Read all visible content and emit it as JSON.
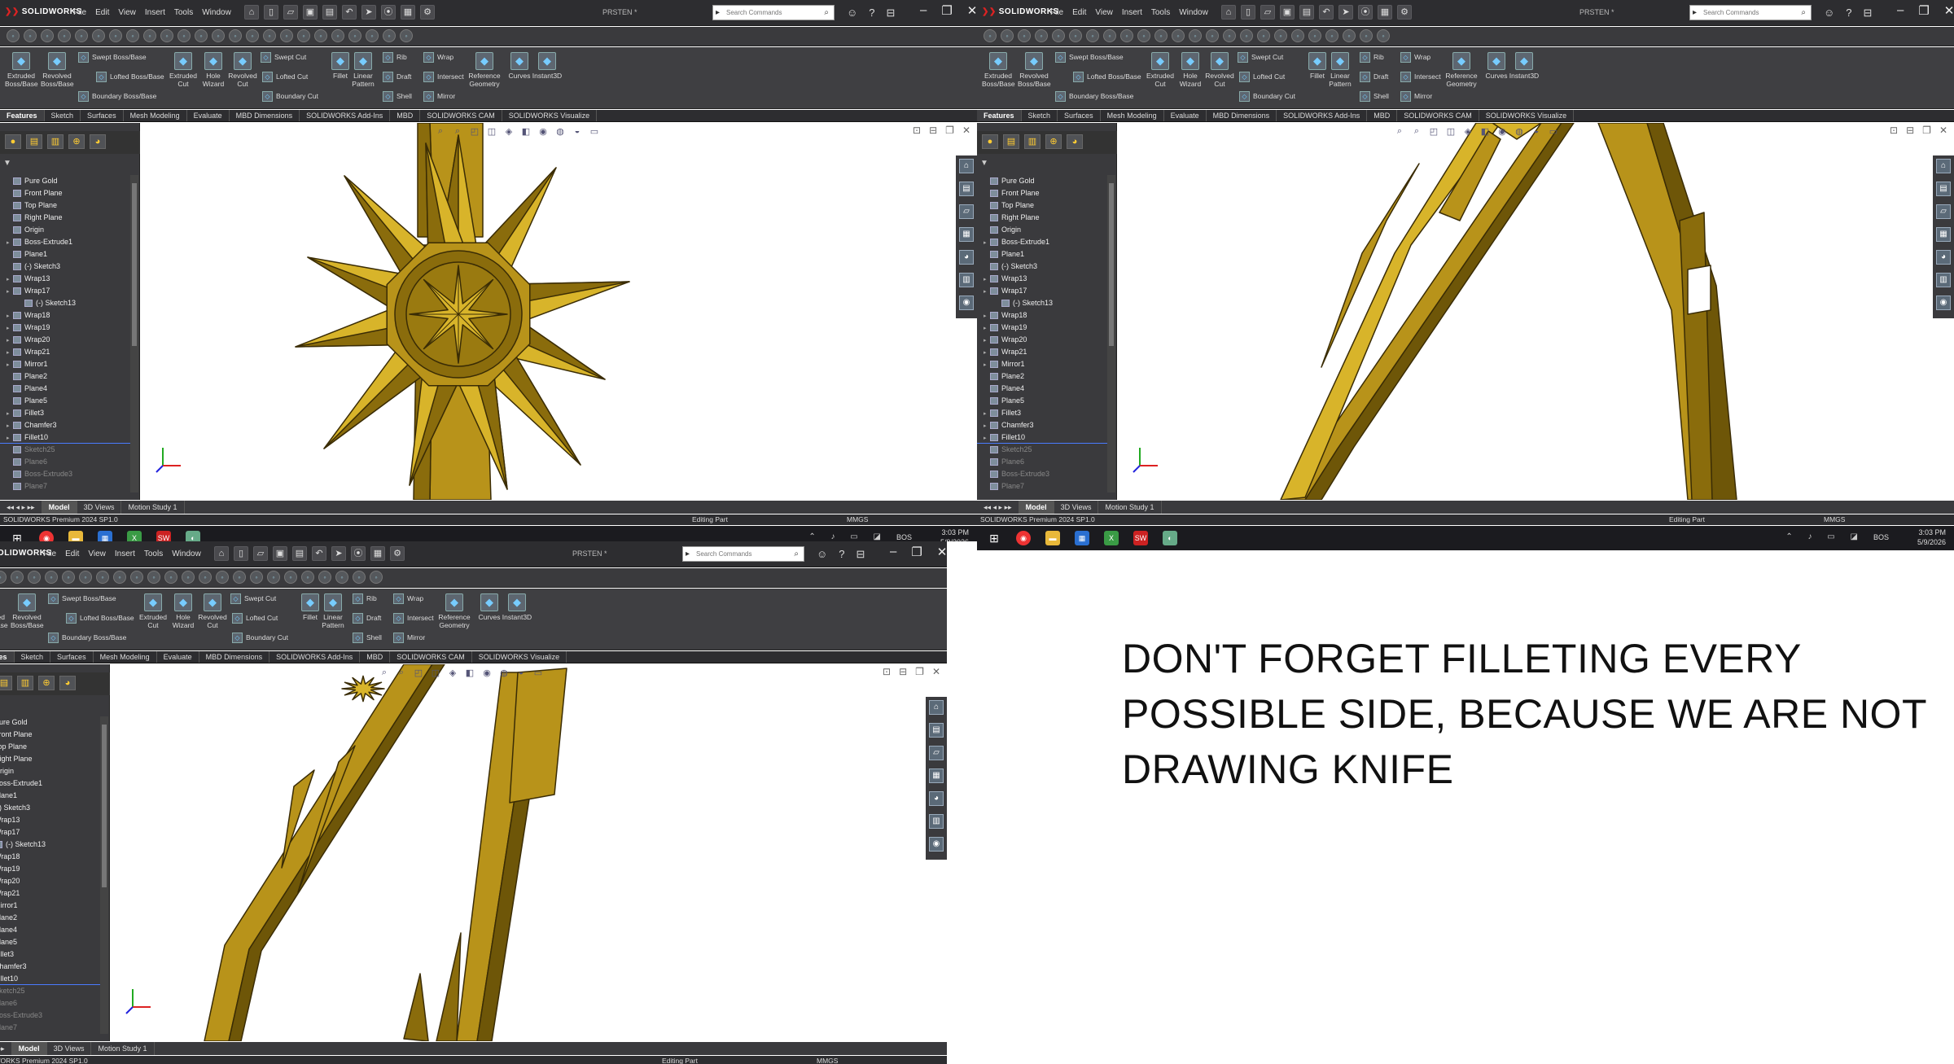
{
  "app": {
    "logo_text": "SOLIDWORKS",
    "menus": [
      "File",
      "Edit",
      "View",
      "Insert",
      "Tools",
      "Window"
    ],
    "document_title": "PRSTEN *",
    "search_placeholder": "Search Commands"
  },
  "ribbon": {
    "big_buttons": [
      {
        "label": "Extruded Boss/Base",
        "icon": "extrude-icon"
      },
      {
        "label": "Revolved Boss/Base",
        "icon": "revolve-icon"
      },
      {
        "label": "Extruded Cut",
        "icon": "extruded-cut-icon"
      },
      {
        "label": "Hole Wizard",
        "icon": "hole-wizard-icon"
      },
      {
        "label": "Revolved Cut",
        "icon": "revolved-cut-icon"
      },
      {
        "label": "Fillet",
        "icon": "fillet-icon"
      },
      {
        "label": "Linear Pattern",
        "icon": "linear-pattern-icon"
      },
      {
        "label": "Reference Geometry",
        "icon": "reference-geometry-icon"
      },
      {
        "label": "Curves",
        "icon": "curves-icon"
      },
      {
        "label": "Instant3D",
        "icon": "instant3d-icon"
      }
    ],
    "small_buttons": [
      {
        "label": "Swept Boss/Base"
      },
      {
        "label": "Lofted Boss/Base"
      },
      {
        "label": "Boundary Boss/Base"
      },
      {
        "label": "Swept Cut"
      },
      {
        "label": "Lofted Cut"
      },
      {
        "label": "Boundary Cut"
      },
      {
        "label": "Rib"
      },
      {
        "label": "Draft"
      },
      {
        "label": "Shell"
      },
      {
        "label": "Wrap"
      },
      {
        "label": "Intersect"
      },
      {
        "label": "Mirror"
      }
    ]
  },
  "tabs": [
    "Features",
    "Sketch",
    "Surfaces",
    "Mesh Modeling",
    "Evaluate",
    "MBD Dimensions",
    "SOLIDWORKS Add-Ins",
    "MBD",
    "SOLIDWORKS CAM",
    "SOLIDWORKS Visualize"
  ],
  "tree": [
    {
      "label": "Pure Gold",
      "type": "material",
      "gray": false
    },
    {
      "label": "Front Plane",
      "type": "plane",
      "gray": false
    },
    {
      "label": "Top Plane",
      "type": "plane",
      "gray": false
    },
    {
      "label": "Right Plane",
      "type": "plane",
      "gray": false
    },
    {
      "label": "Origin",
      "type": "origin",
      "gray": false
    },
    {
      "label": "Boss-Extrude1",
      "type": "feature",
      "gray": false
    },
    {
      "label": "Plane1",
      "type": "plane",
      "gray": false
    },
    {
      "label": "(-) Sketch3",
      "type": "sketch",
      "gray": false
    },
    {
      "label": "Wrap13",
      "type": "feature",
      "gray": false
    },
    {
      "label": "Wrap17",
      "type": "feature",
      "gray": false
    },
    {
      "label": "(-) Sketch13",
      "type": "sketch",
      "gray": false,
      "child": true
    },
    {
      "label": "Wrap18",
      "type": "feature",
      "gray": false
    },
    {
      "label": "Wrap19",
      "type": "feature",
      "gray": false
    },
    {
      "label": "Wrap20",
      "type": "feature",
      "gray": false
    },
    {
      "label": "Wrap21",
      "type": "feature",
      "gray": false
    },
    {
      "label": "Mirror1",
      "type": "feature",
      "gray": false
    },
    {
      "label": "Plane2",
      "type": "plane",
      "gray": false
    },
    {
      "label": "Plane4",
      "type": "plane",
      "gray": false
    },
    {
      "label": "Plane5",
      "type": "plane",
      "gray": false
    },
    {
      "label": "Fillet3",
      "type": "feature",
      "gray": false
    },
    {
      "label": "Chamfer3",
      "type": "feature",
      "gray": false
    },
    {
      "label": "Fillet10",
      "type": "feature",
      "gray": false,
      "selected": true
    },
    {
      "label": "Sketch25",
      "type": "sketch",
      "gray": true
    },
    {
      "label": "Plane6",
      "type": "plane",
      "gray": true
    },
    {
      "label": "Boss-Extrude3",
      "type": "feature",
      "gray": true
    },
    {
      "label": "Plane7",
      "type": "plane",
      "gray": true
    }
  ],
  "bottom_tabs": [
    "Model",
    "3D Views",
    "Motion Study 1"
  ],
  "status": {
    "left": "SOLIDWORKS Premium 2024 SP1.0",
    "middle": "Editing Part",
    "units": "MMGS"
  },
  "taskbar": {
    "language": "BOS",
    "time": "3:03 PM",
    "date": "5/9/2026"
  },
  "note": "DON'T FORGET FILLETING EVERY POSSIBLE SIDE, BECAUSE WE ARE NOT DRAWING KNIFE"
}
